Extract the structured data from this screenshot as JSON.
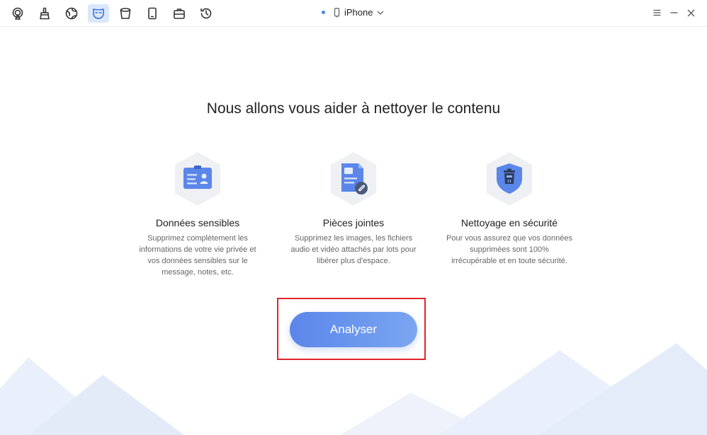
{
  "toolbar": {
    "tools": [
      {
        "icon": "airplay-icon",
        "active": false
      },
      {
        "icon": "cleaner-icon",
        "active": false
      },
      {
        "icon": "globe-icon",
        "active": false
      },
      {
        "icon": "privacy-mask-icon",
        "active": true
      },
      {
        "icon": "trash-icon",
        "active": false
      },
      {
        "icon": "tablet-icon",
        "active": false
      },
      {
        "icon": "toolbox-icon",
        "active": false
      },
      {
        "icon": "history-icon",
        "active": false
      }
    ]
  },
  "device": {
    "name": "iPhone",
    "status_color": "#4a86e8"
  },
  "window_controls": {
    "menu_icon": "menu-icon",
    "minimize_icon": "minimize-icon",
    "close_icon": "close-icon"
  },
  "main": {
    "title": "Nous allons vous aider à nettoyer le contenu",
    "features": [
      {
        "icon": "id-card-icon",
        "title": "Données sensibles",
        "description": "Supprimez complètement les informations de votre vie privée et vos données sensibles sur le message, notes, etc."
      },
      {
        "icon": "attachment-document-icon",
        "title": "Pièces jointes",
        "description": "Supprimez les images, les fichiers audio et vidéo attachés par lots pour libérer plus d'espace."
      },
      {
        "icon": "shield-trash-icon",
        "title": "Nettoyage en sécurité",
        "description": "Pour vous assurez que vos données supprimées sont 100% irrécupérable et en toute sécurité."
      }
    ],
    "analyze_button": "Analyser"
  },
  "colors": {
    "accent": "#5b86ea",
    "highlight_border": "#e3242b",
    "hex_bg": "#eef0f4"
  }
}
